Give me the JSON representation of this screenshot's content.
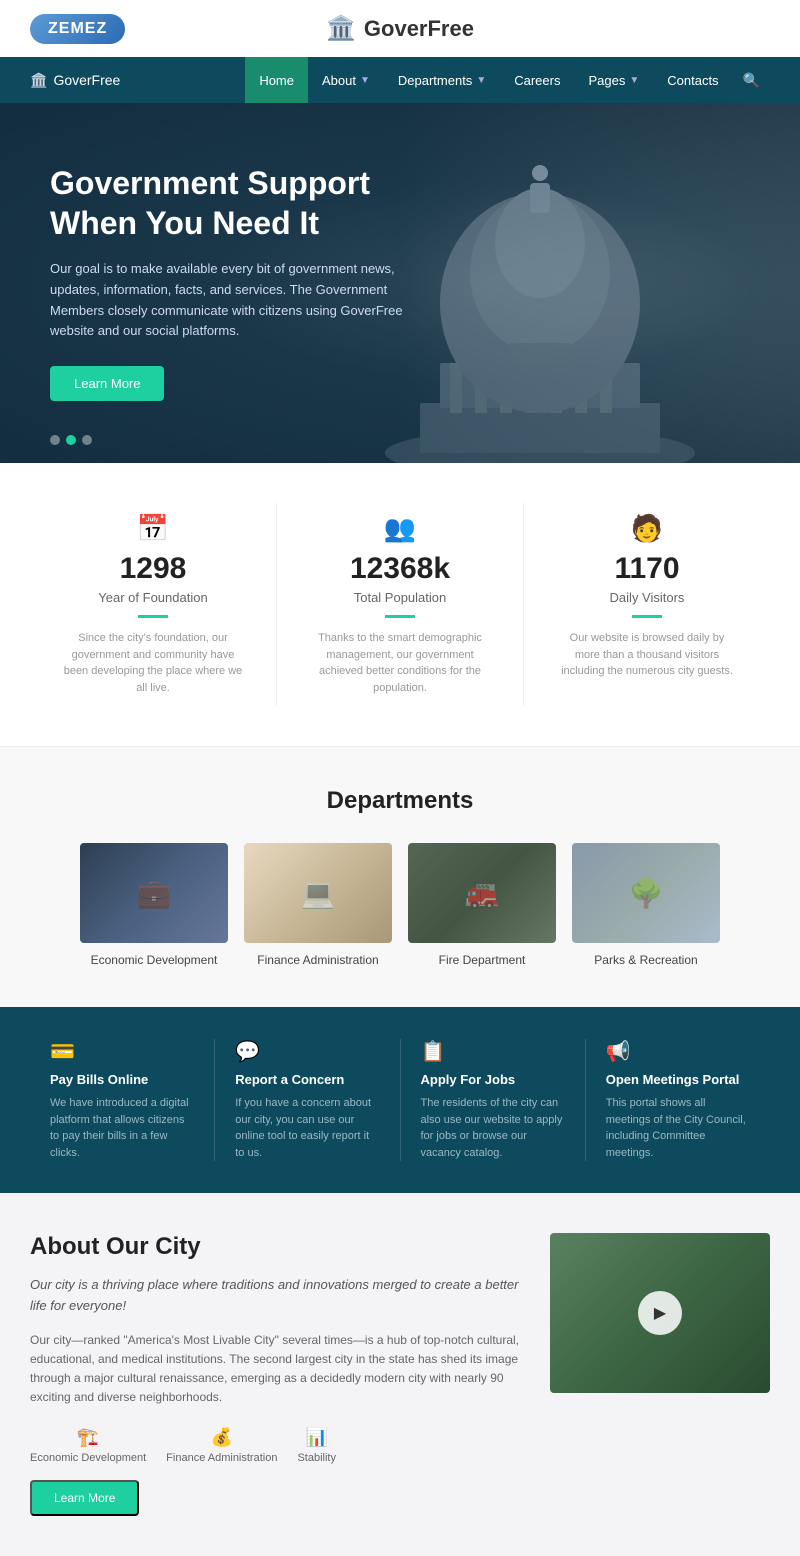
{
  "topBar": {
    "zemez": "ZEMEZ",
    "siteTitle": "GoverFree"
  },
  "navbar": {
    "brand": "GoverFree",
    "links": [
      {
        "label": "Home",
        "active": true,
        "hasDropdown": false
      },
      {
        "label": "About",
        "active": false,
        "hasDropdown": true
      },
      {
        "label": "Departments",
        "active": false,
        "hasDropdown": true
      },
      {
        "label": "Careers",
        "active": false,
        "hasDropdown": false
      },
      {
        "label": "Pages",
        "active": false,
        "hasDropdown": true
      },
      {
        "label": "Contacts",
        "active": false,
        "hasDropdown": false
      }
    ]
  },
  "hero": {
    "title": "Government Support When You Need It",
    "description": "Our goal is to make available every bit of government news, updates, information, facts, and services. The Government Members closely communicate with citizens using GoverFree website and our social platforms.",
    "buttonLabel": "Learn More"
  },
  "stats": [
    {
      "icon": "📅",
      "number": "1298",
      "label": "Year of Foundation",
      "description": "Since the city's foundation, our government and community have been developing the place where we all live."
    },
    {
      "icon": "👥",
      "number": "12368k",
      "label": "Total Population",
      "description": "Thanks to the smart demographic management, our government achieved better conditions for the population."
    },
    {
      "icon": "🧑",
      "number": "1170",
      "label": "Daily Visitors",
      "description": "Our website is browsed daily by more than a thousand visitors including the numerous city guests."
    }
  ],
  "departments": {
    "title": "Departments",
    "items": [
      {
        "label": "Economic Development",
        "imgClass": "dept-img-econ"
      },
      {
        "label": "Finance Administration",
        "imgClass": "dept-img-finance"
      },
      {
        "label": "Fire Department",
        "imgClass": "dept-img-fire"
      },
      {
        "label": "Parks & Recreation",
        "imgClass": "dept-img-parks"
      }
    ]
  },
  "services": [
    {
      "icon": "💳",
      "title": "Pay Bills Online",
      "description": "We have introduced a digital platform that allows citizens to pay their bills in a few clicks."
    },
    {
      "icon": "💬",
      "title": "Report a Concern",
      "description": "If you have a concern about our city, you can use our online tool to easily report it to us."
    },
    {
      "icon": "📋",
      "title": "Apply For Jobs",
      "description": "The residents of the city can also use our website to apply for jobs or browse our vacancy catalog."
    },
    {
      "icon": "📢",
      "title": "Open Meetings Portal",
      "description": "This portal shows all meetings of the City Council, including Committee meetings."
    }
  ],
  "about": {
    "title": "About Our City",
    "subtitle": "Our city is a thriving place where traditions and innovations merged to create a better life for everyone!",
    "description": "Our city—ranked \"America's Most Livable City\" several times—is a hub of top-notch cultural, educational, and medical institutions. The second largest city in the state has shed its image through a major cultural renaissance, emerging as a decidedly modern city with nearly 90 exciting and diverse neighborhoods.",
    "icons": [
      {
        "icon": "🏗️",
        "label": "Economic Development"
      },
      {
        "icon": "💰",
        "label": "Finance Administration"
      },
      {
        "icon": "📊",
        "label": "Stability"
      }
    ],
    "btnLabel": "Learn More"
  }
}
